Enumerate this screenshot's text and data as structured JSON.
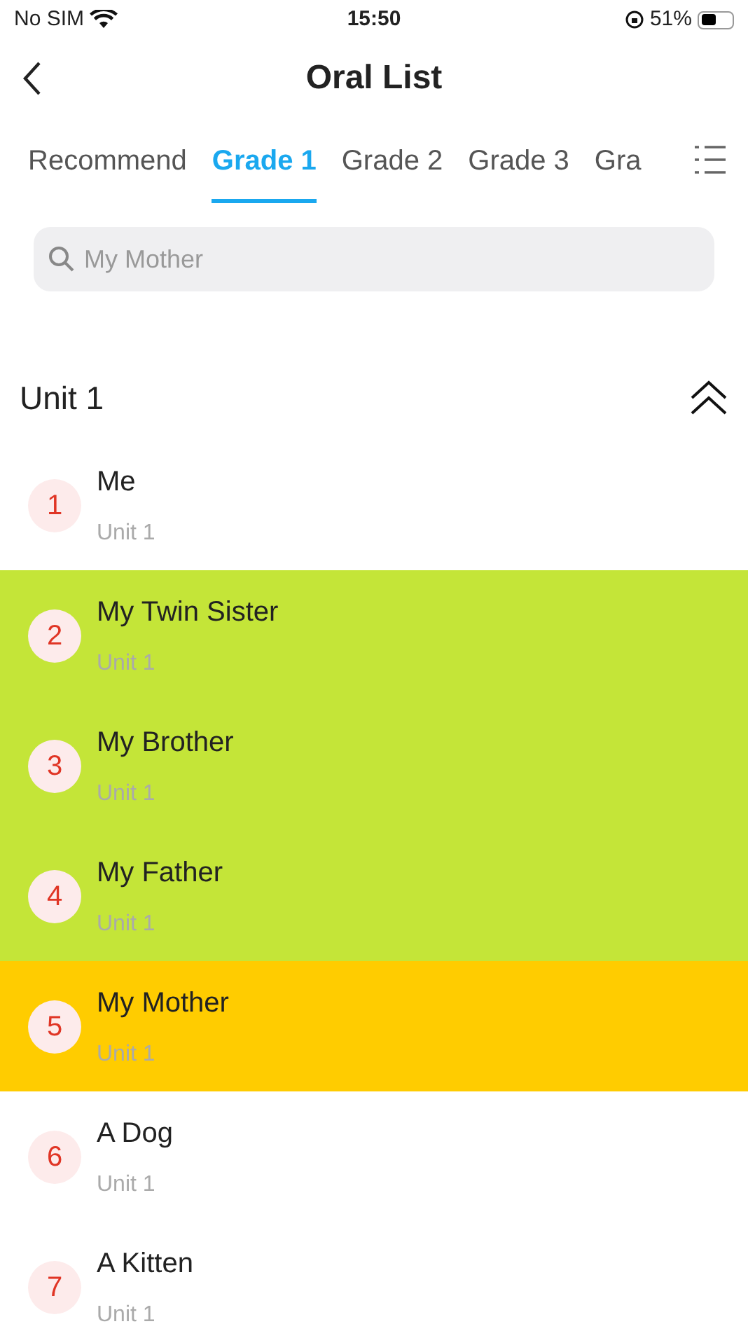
{
  "status_bar": {
    "carrier": "No SIM",
    "time": "15:50",
    "battery": "51%",
    "battery_meter": {
      "level": 0.51
    }
  },
  "nav": {
    "title": "Oral List"
  },
  "tabs": [
    {
      "label": "Recommend",
      "selected": false
    },
    {
      "label": "Grade 1",
      "selected": true
    },
    {
      "label": "Grade 2",
      "selected": false
    },
    {
      "label": "Grade 3",
      "selected": false
    },
    {
      "label": "Gra",
      "selected": false
    }
  ],
  "search": {
    "placeholder": "My Mother"
  },
  "unit": {
    "title": "Unit 1",
    "expanded": true
  },
  "lessons": [
    {
      "number": "1",
      "title": "Me",
      "subtitle": "Unit 1"
    },
    {
      "number": "2",
      "title": "My Twin Sister",
      "subtitle": "Unit 1",
      "color": "#c4e538"
    },
    {
      "number": "3",
      "title": "My Brother",
      "subtitle": "Unit 1",
      "color": "#c4e538"
    },
    {
      "number": "4",
      "title": "My Father",
      "subtitle": "Unit 1",
      "color": "#c4e538"
    },
    {
      "number": "5",
      "title": "My Mother",
      "subtitle": "Unit 1",
      "color": "#ffcc00"
    },
    {
      "number": "6",
      "title": "A Dog",
      "subtitle": "Unit 1"
    },
    {
      "number": "7",
      "title": "A Kitten",
      "subtitle": "Unit 1"
    }
  ]
}
